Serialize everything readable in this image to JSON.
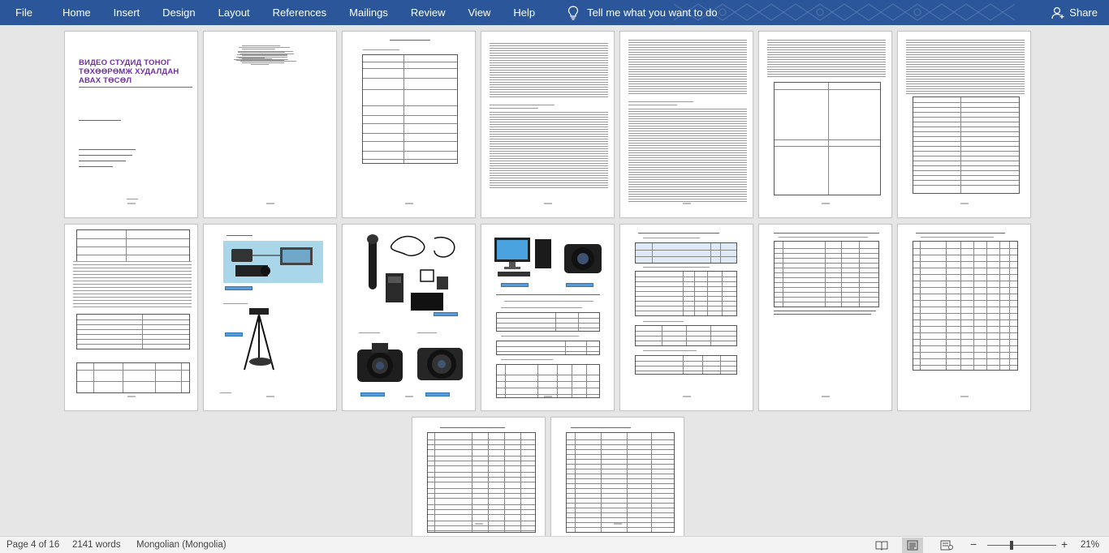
{
  "ribbon": {
    "tabs": [
      "File",
      "Home",
      "Insert",
      "Design",
      "Layout",
      "References",
      "Mailings",
      "Review",
      "View",
      "Help"
    ],
    "tell_me": "Tell me what you want to do",
    "share": "Share",
    "accent": "#2b579a"
  },
  "cover": {
    "title_lines": [
      "ВИДЕО СТУДИД ТОНОГ",
      "ТӨХӨӨРӨМЖ ХУДАЛДАН",
      "АВАХ ТӨСӨЛ"
    ],
    "title_color": "#7030a0"
  },
  "status": {
    "page": "Page 4 of 16",
    "words": "2141 words",
    "language": "Mongolian (Mongolia)",
    "zoom_percent": "21%",
    "zoom_minus": "−",
    "zoom_plus": "+"
  },
  "icons": {
    "tell_me": "lightbulb-icon",
    "share": "person-icon",
    "read_mode": "book-icon",
    "print_layout": "page-icon",
    "web_layout": "web-icon"
  }
}
